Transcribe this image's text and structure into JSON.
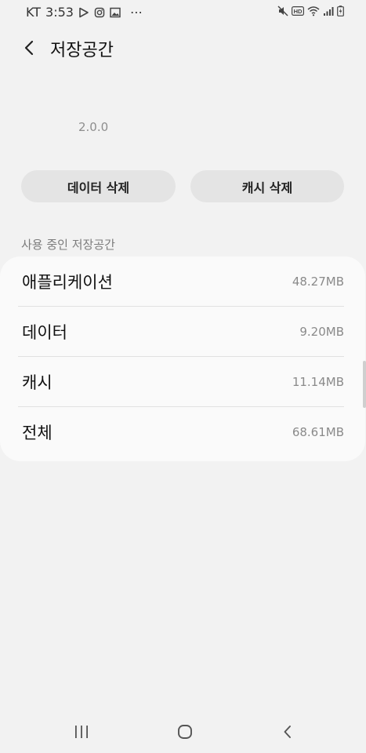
{
  "status_bar": {
    "carrier": "KT",
    "time": "3:53",
    "overflow": "⋯",
    "left_icons": [
      "play-store-icon",
      "instagram-icon",
      "gallery-icon"
    ],
    "right_icons": [
      "mute-icon",
      "hd-icon",
      "wifi-icon",
      "signal-icon",
      "battery-icon"
    ]
  },
  "header": {
    "title": "저장공간",
    "back_icon": "back-icon"
  },
  "app_info": {
    "version": "2.0.0"
  },
  "actions": {
    "clear_data": "데이터 삭제",
    "clear_cache": "캐시 삭제"
  },
  "storage": {
    "section_title": "사용 중인 저장공간",
    "rows": [
      {
        "label": "애플리케이션",
        "value": "48.27MB"
      },
      {
        "label": "데이터",
        "value": "9.20MB"
      },
      {
        "label": "캐시",
        "value": "11.14MB"
      },
      {
        "label": "전체",
        "value": "68.61MB"
      }
    ]
  },
  "navigation": {
    "icons": [
      "recent-apps-icon",
      "home-icon",
      "back-icon"
    ]
  },
  "colors": {
    "background": "#f2f2f2",
    "card": "#fafafa",
    "button": "#e4e4e4",
    "secondary_text": "#8a8a8a"
  }
}
